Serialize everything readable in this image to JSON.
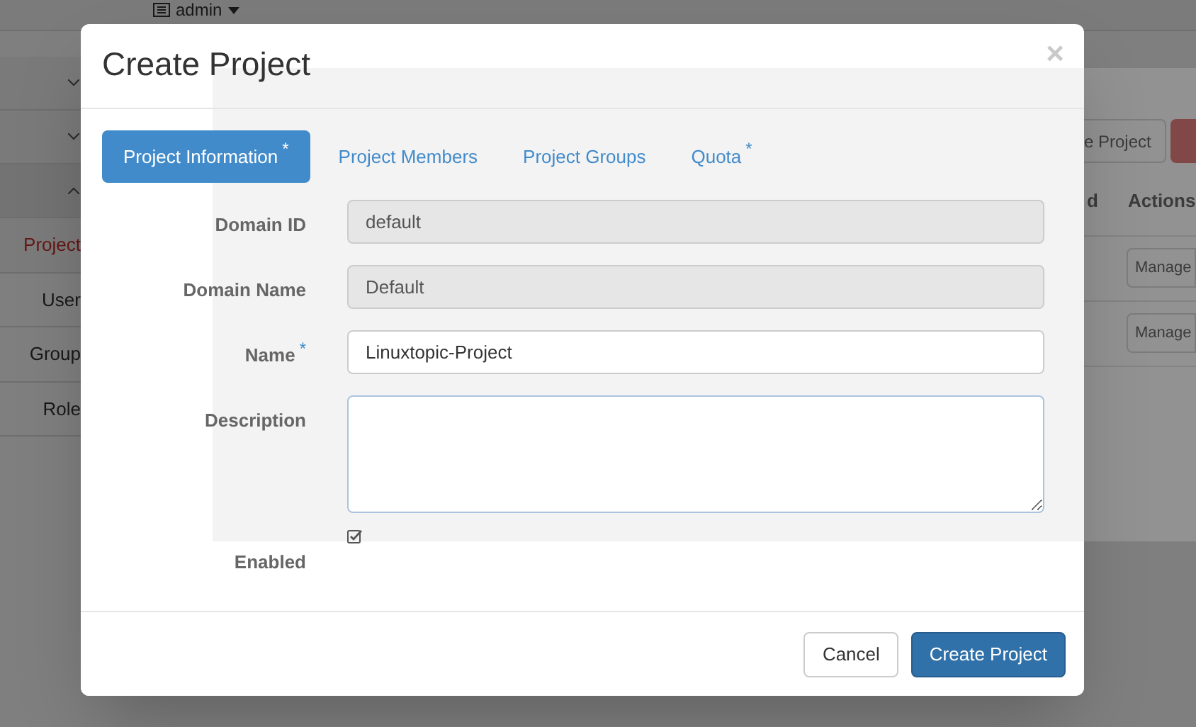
{
  "top_bar": {
    "user_menu": "admin"
  },
  "sidebar": {
    "items": [
      {
        "kind": "group",
        "expanded": false
      },
      {
        "kind": "group",
        "expanded": false
      },
      {
        "kind": "group",
        "expanded": true
      },
      {
        "kind": "link",
        "label": "Project",
        "selected": true
      },
      {
        "kind": "link",
        "label": "User",
        "selected": false
      },
      {
        "kind": "link",
        "label": "Group",
        "selected": false
      },
      {
        "kind": "link",
        "label": "Role",
        "selected": false
      }
    ]
  },
  "page": {
    "create_button": "e Project",
    "table": {
      "columns": [
        "d",
        "Actions"
      ],
      "rows": [
        {
          "action": "Manage"
        },
        {
          "action": "Manage"
        }
      ]
    }
  },
  "modal": {
    "title": "Create Project",
    "close": "×",
    "tabs": [
      {
        "label": "Project Information",
        "marker": "*",
        "selected": true
      },
      {
        "label": "Project Members",
        "selected": false
      },
      {
        "label": "Project Groups",
        "selected": false
      },
      {
        "label": "Quota",
        "marker": "*",
        "selected": false
      }
    ],
    "fields": [
      {
        "kind": "text",
        "label": "Domain ID",
        "disabled": true,
        "value": "default"
      },
      {
        "kind": "text",
        "label": "Domain Name",
        "disabled": true,
        "value": "Default"
      },
      {
        "kind": "text",
        "label": "Name",
        "marker": "*",
        "disabled": false,
        "value": "Linuxtopic-Project"
      },
      {
        "kind": "textarea",
        "label": "Description"
      },
      {
        "kind": "checkbox",
        "label": "Enabled",
        "checked": true
      }
    ],
    "buttons": [
      {
        "label": "Cancel",
        "primary": false
      },
      {
        "label": "Create Project",
        "primary": true
      }
    ]
  }
}
